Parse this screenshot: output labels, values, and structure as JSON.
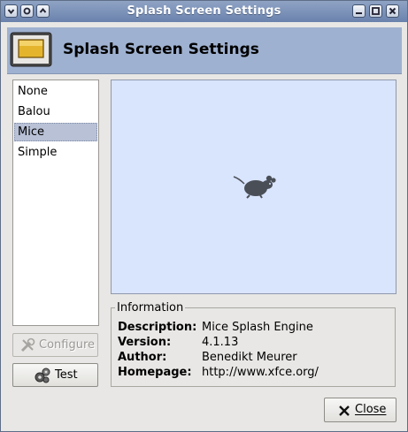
{
  "window": {
    "title": "Splash Screen Settings"
  },
  "header": {
    "title": "Splash Screen Settings",
    "icon": "splash-settings-icon"
  },
  "themes": {
    "items": [
      "None",
      "Balou",
      "Mice",
      "Simple"
    ],
    "selected": "Mice"
  },
  "preview": {
    "icon": "mouse-icon",
    "background": "#d9e4fd"
  },
  "info": {
    "legend": "Information",
    "description_label": "Description:",
    "description": "Mice Splash Engine",
    "version_label": "Version:",
    "version": "4.1.13",
    "author_label": "Author:",
    "author": "Benedikt Meurer",
    "homepage_label": "Homepage:",
    "homepage": "http://www.xfce.org/"
  },
  "buttons": {
    "configure": "Configure",
    "test": "Test",
    "close": "Close"
  },
  "colors": {
    "titlebar": "#7b90b8",
    "header": "#9fb1d0",
    "selection": "#b8c1d6"
  }
}
